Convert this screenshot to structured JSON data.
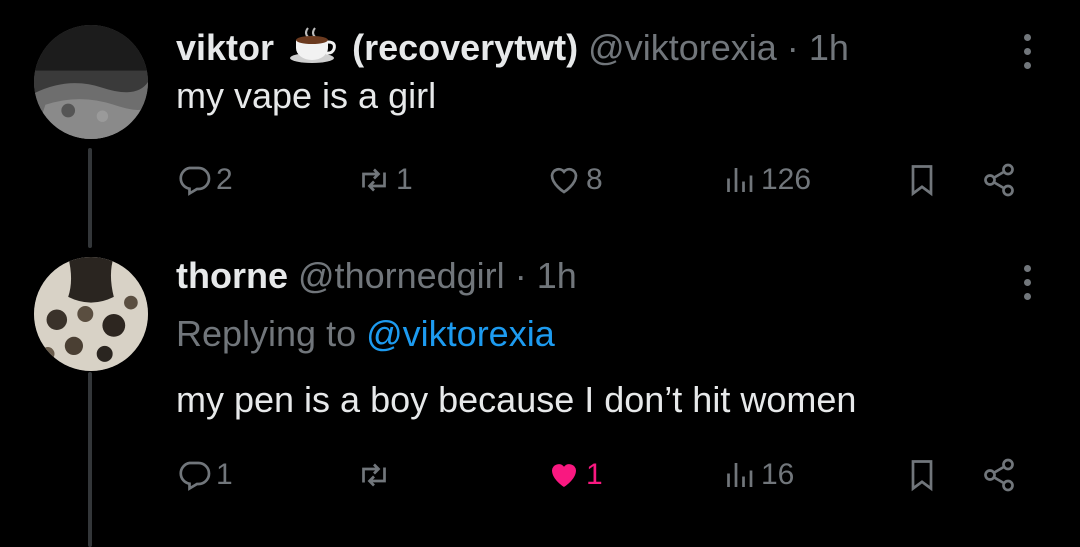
{
  "tweets": [
    {
      "name": "viktor",
      "name_suffix": "(recoverytwt)",
      "emoji_icon": "hot-beverage-emoji",
      "handle": "@viktorexia",
      "separator": "·",
      "time": "1h",
      "text": "my vape is a girl",
      "replies": "2",
      "retweets": "1",
      "likes": "8",
      "views": "126",
      "liked": false
    },
    {
      "name": "thorne",
      "handle": "@thornedgirl",
      "separator": "·",
      "time": "1h",
      "replying_label": "Replying to",
      "replying_handle": "@viktorexia",
      "text": "my pen is a boy because I don’t hit women",
      "replies": "1",
      "retweets": "",
      "likes": "1",
      "views": "16",
      "liked": true
    }
  ],
  "colors": {
    "background": "#000000",
    "text": "#e7e9ea",
    "muted": "#71767b",
    "link": "#1d9bf0",
    "like_active": "#f91880"
  }
}
